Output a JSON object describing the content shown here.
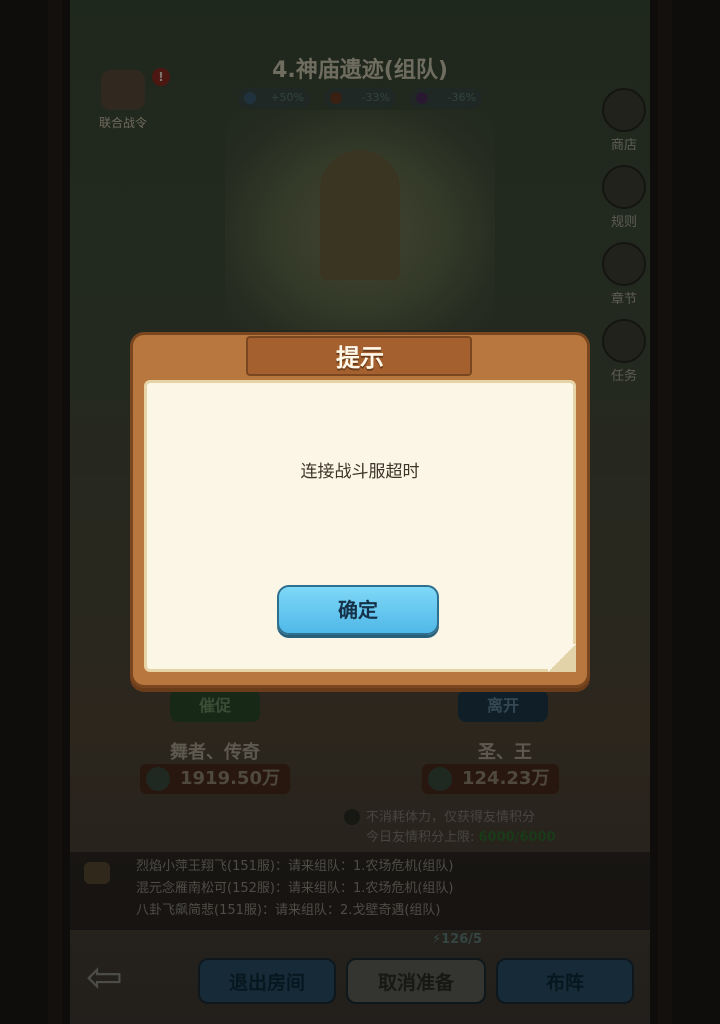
{
  "header": {
    "stage_title": "4.神庙遗迹(组队)",
    "buffs": [
      "+50%",
      "-33%",
      "-36%"
    ],
    "alliance_label": "联合战令",
    "alliance_badge": "!"
  },
  "side_menu": {
    "items": [
      {
        "label": "商店",
        "icon": "shop-icon"
      },
      {
        "label": "规则",
        "icon": "rules-icon"
      },
      {
        "label": "章节",
        "icon": "book-icon"
      },
      {
        "label": "任务",
        "icon": "task-icon"
      }
    ]
  },
  "players": {
    "left": {
      "action": "催促",
      "name": "舞者、传奇",
      "power": "1919.50万"
    },
    "right": {
      "action": "离开",
      "name": "圣、王",
      "power": "124.23万"
    }
  },
  "friendship": {
    "line1": "不消耗体力，仅获得友情积分",
    "line2_prefix": "今日友情积分上限: ",
    "line2_value": "6000/6000"
  },
  "chat": {
    "lines": [
      "烈焰小萍王翔飞(151服)：请来组队：1.农场危机(组队)",
      "混元念雁南松可(152服)：请来组队：1.农场危机(组队)",
      "八卦飞飙简悲(151服)：请来组队：2.戈壁奇遇(组队)"
    ]
  },
  "energy": "126/5",
  "bottom": {
    "back_icon": "back-arrow-icon",
    "exit_label": "退出房间",
    "cancel_label": "取消准备",
    "formation_label": "布阵"
  },
  "modal": {
    "title": "提示",
    "message": "连接战斗服超时",
    "ok_label": "确定"
  },
  "colors": {
    "modal_frame": "#b8773e",
    "ok_button": "#50b8e8",
    "paper": "#fbf6e6"
  }
}
